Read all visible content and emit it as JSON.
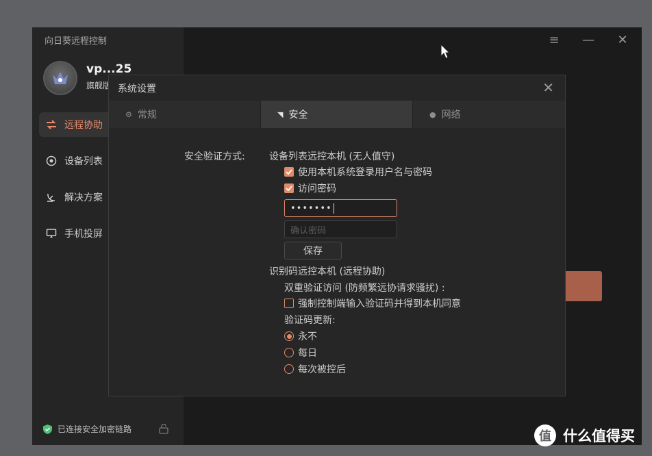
{
  "app": {
    "title": "向日葵远程控制",
    "user_name": "vp...25",
    "user_tier": "旗舰版"
  },
  "sidebar": {
    "items": [
      {
        "label": "远程协助",
        "icon": "swap-arrows-icon",
        "active": true
      },
      {
        "label": "设备列表",
        "icon": "device-list-icon",
        "active": false
      },
      {
        "label": "解决方案",
        "icon": "satellite-icon",
        "active": false
      },
      {
        "label": "手机投屏",
        "icon": "screen-cast-icon",
        "active": false
      }
    ],
    "status_text": "已连接安全加密链路"
  },
  "window_controls": {
    "menu": "≡",
    "minimize": "—",
    "close": "✕"
  },
  "dialog": {
    "title": "系统设置",
    "close": "✕",
    "tabs": [
      {
        "label": "常规",
        "icon": "gear-icon",
        "active": false
      },
      {
        "label": "安全",
        "icon": "shield-icon",
        "active": true
      },
      {
        "label": "网络",
        "icon": "globe-icon",
        "active": false
      }
    ],
    "security": {
      "method_label": "安全验证方式:",
      "section1_title": "设备列表远控本机 (无人值守)",
      "option_system_login": {
        "label": "使用本机系统登录用户名与密码",
        "checked": true
      },
      "option_access_password": {
        "label": "访问密码",
        "checked": true
      },
      "password_value": "•••••••",
      "confirm_placeholder": "确认密码",
      "save_label": "保存",
      "section2_title": "识别码远控本机 (远程协助)",
      "two_factor_label": "双重验证访问 (防频繁远协请求骚扰) :",
      "option_force_code": {
        "label": "强制控制端输入验证码并得到本机同意",
        "checked": false
      },
      "code_refresh_label": "验证码更新:",
      "refresh_options": [
        {
          "label": "永不",
          "selected": true
        },
        {
          "label": "每日",
          "selected": false
        },
        {
          "label": "每次被控后",
          "selected": false
        }
      ]
    }
  },
  "watermark": {
    "text": "什么值得买",
    "icon_char": "值"
  },
  "colors": {
    "accent": "#e08a6a",
    "sidebar_bg": "#252525",
    "dialog_bg": "#262626"
  }
}
